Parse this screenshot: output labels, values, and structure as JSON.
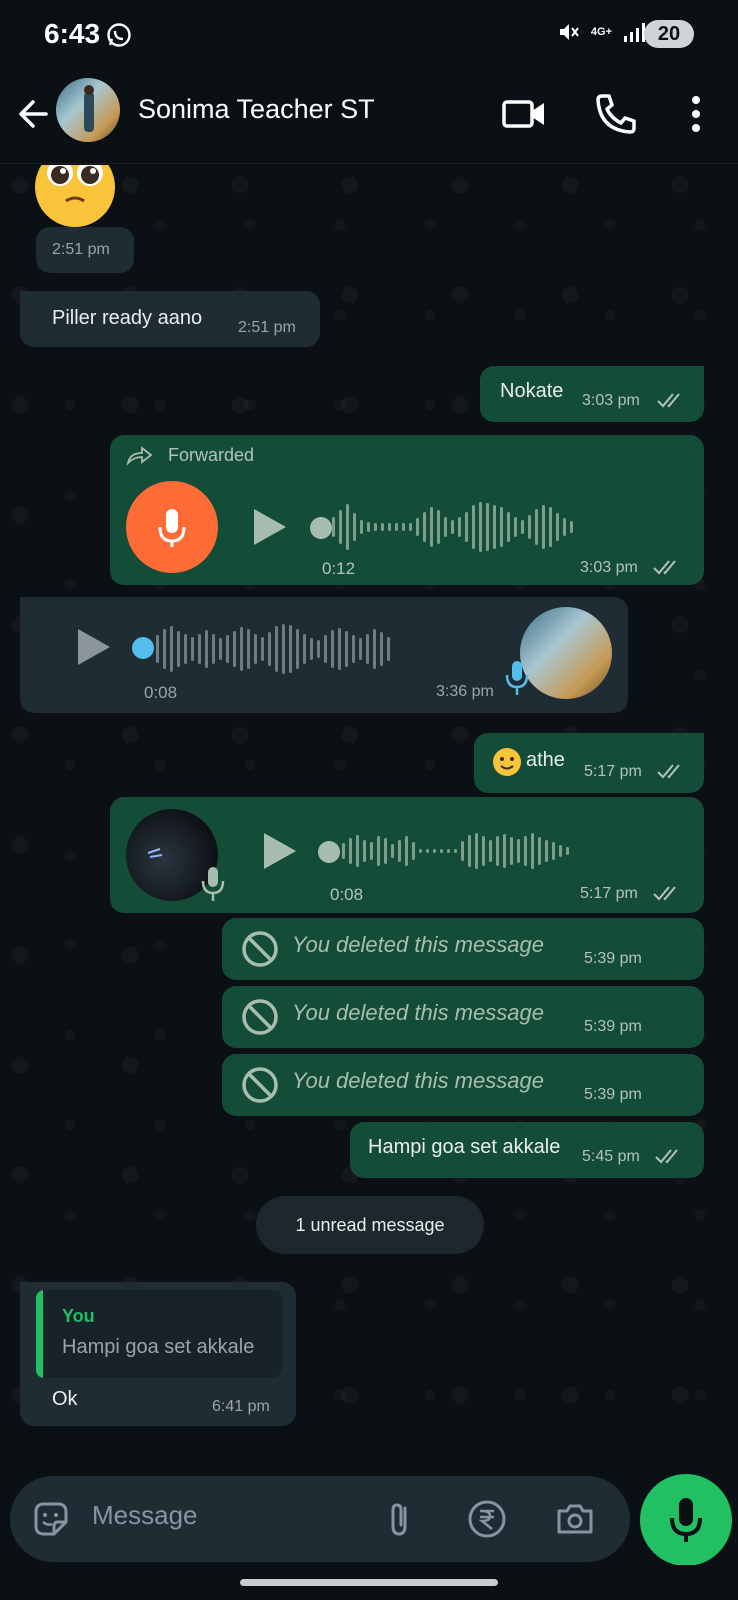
{
  "status_bar": {
    "time": "6:43",
    "network": "4G+",
    "battery": "20"
  },
  "header": {
    "contact_name": "Sonima Teacher ST"
  },
  "messages": {
    "m1_time": "2:51 pm",
    "m2_text": "Piller ready aano",
    "m2_time": "2:51 pm",
    "m3_text": "Nokate",
    "m3_time": "3:03 pm",
    "m4_forwarded": "Forwarded",
    "m4_duration": "0:12",
    "m4_time": "3:03 pm",
    "m5_duration": "0:08",
    "m5_time": "3:36 pm",
    "m6_text": "athe",
    "m6_time": "5:17 pm",
    "m7_duration": "0:08",
    "m7_time": "5:17 pm",
    "deleted_text": "You deleted this message",
    "d1_time": "5:39 pm",
    "d2_time": "5:39 pm",
    "d3_time": "5:39 pm",
    "m8_text": "Hampi goa set akkale",
    "m8_time": "5:45 pm",
    "unread_label": "1 unread message",
    "reply_sender": "You",
    "reply_quote": "Hampi goa set akkale",
    "m9_text": "Ok",
    "m9_time": "6:41 pm"
  },
  "composer": {
    "placeholder": "Message"
  },
  "colors": {
    "outgoing": "#144d37",
    "incoming": "#202c33",
    "accent": "#21c063",
    "forward_mic": "#ff6b35",
    "playing_dot": "#53bdeb"
  }
}
